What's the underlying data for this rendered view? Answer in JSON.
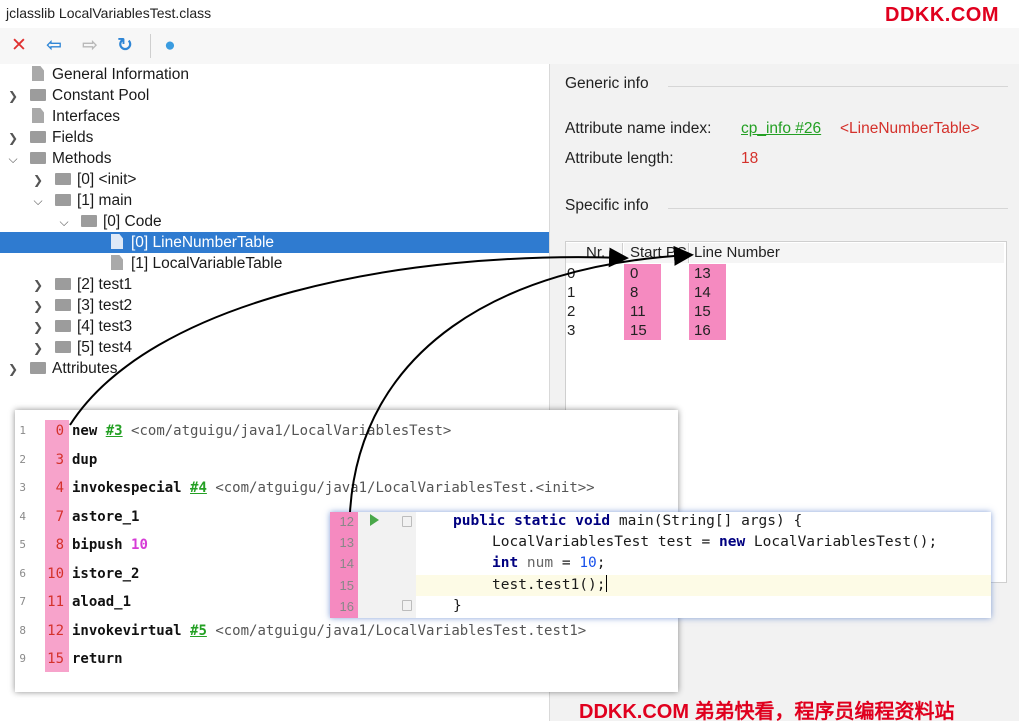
{
  "window": {
    "title": "jclasslib LocalVariablesTest.class"
  },
  "watermark": {
    "top": "DDKK.COM",
    "bottom": "DDKK.COM 弟弟快看，程序员编程资料站"
  },
  "toolbar": [
    {
      "icon": "close-icon",
      "glyph": "✕",
      "color": "#e03131"
    },
    {
      "icon": "back-arrow-icon",
      "glyph": "⇦",
      "color": "#2f86d6"
    },
    {
      "icon": "forward-arrow-icon",
      "glyph": "⇨",
      "color": "#b9b9b9"
    },
    {
      "icon": "refresh-icon",
      "glyph": "↻",
      "color": "#2f86d6"
    },
    {
      "icon": "web-globe-icon",
      "glyph": "●",
      "color": "#3a9ce0"
    }
  ],
  "tree": {
    "general": "General Information",
    "constant_pool": "Constant Pool",
    "interfaces": "Interfaces",
    "fields": "Fields",
    "methods": "Methods",
    "m0": "[0] <init>",
    "m1": "[1] main",
    "code": "[0] Code",
    "lnt": "[0] LineNumberTable",
    "lvt": "[1] LocalVariableTable",
    "m2": "[2] test1",
    "m3": "[3] test2",
    "m4": "[4] test3",
    "m5": "[5] test4",
    "attributes": "Attributes"
  },
  "generic_info": {
    "heading": "Generic info",
    "name_index_label": "Attribute name index:",
    "name_index_link": "cp_info #26",
    "name_index_value": "<LineNumberTable>",
    "length_label": "Attribute length:",
    "length_value": "18"
  },
  "specific_info": {
    "heading": "Specific info",
    "columns": [
      "Nr.",
      "Start PC",
      "Line Number"
    ],
    "rows": [
      [
        "0",
        "0",
        "13"
      ],
      [
        "1",
        "8",
        "14"
      ],
      [
        "2",
        "11",
        "15"
      ],
      [
        "3",
        "15",
        "16"
      ]
    ]
  },
  "bytecode": {
    "lines": [
      {
        "ln": "1",
        "off": "0",
        "op": "new",
        "ref": "#3",
        "arg": "<com/atguigu/java1/LocalVariablesTest>"
      },
      {
        "ln": "2",
        "off": "3",
        "op": "dup"
      },
      {
        "ln": "3",
        "off": "4",
        "op": "invokespecial",
        "ref": "#4",
        "arg": "<com/atguigu/java1/LocalVariablesTest.<init>>"
      },
      {
        "ln": "4",
        "off": "7",
        "op": "astore_1"
      },
      {
        "ln": "5",
        "off": "8",
        "op": "bipush",
        "num": "10"
      },
      {
        "ln": "6",
        "off": "10",
        "op": "istore_2"
      },
      {
        "ln": "7",
        "off": "11",
        "op": "aload_1"
      },
      {
        "ln": "8",
        "off": "12",
        "op": "invokevirtual",
        "ref": "#5",
        "arg": "<com/atguigu/java1/LocalVariablesTest.test1>"
      },
      {
        "ln": "9",
        "off": "15",
        "op": "return"
      }
    ]
  },
  "source": {
    "lines": [
      {
        "ln": "12",
        "k1": "public static void",
        "t1": " main(String[] args) {"
      },
      {
        "ln": "13",
        "t1": "LocalVariablesTest test = ",
        "k1": "new",
        "t2": " LocalVariablesTest();"
      },
      {
        "ln": "14",
        "k1": "int",
        "g1": " num",
        "t1": " = ",
        "n1": "10",
        "t2": ";"
      },
      {
        "ln": "15",
        "t1": "test.test1();"
      },
      {
        "ln": "16",
        "t1": "}"
      }
    ]
  }
}
